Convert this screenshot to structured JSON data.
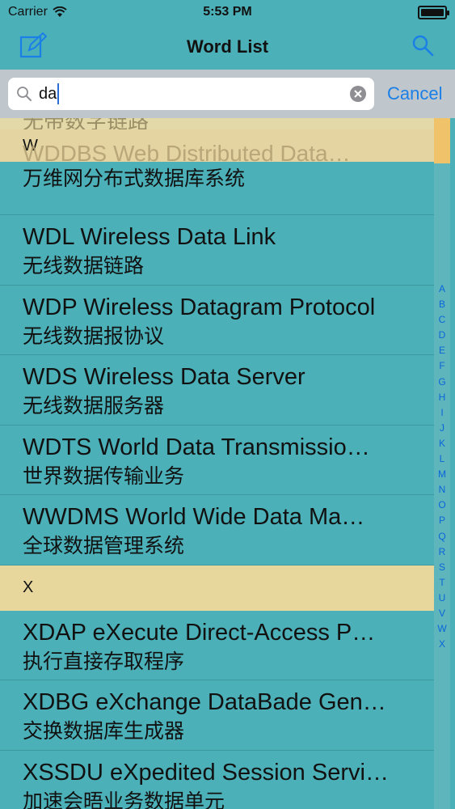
{
  "status_bar": {
    "carrier": "Carrier",
    "time": "5:53 PM"
  },
  "nav": {
    "title": "Word List",
    "left_icon": "compose-icon",
    "right_icon": "search-icon"
  },
  "search": {
    "value": "da",
    "cancel_label": "Cancel"
  },
  "peek_text": "无带数字链路",
  "sections": [
    {
      "header": "W",
      "ghost": "WDDBS Web Distributed Data…",
      "rows": [
        {
          "term": "",
          "meaning": "万维网分布式数据库系统"
        },
        {
          "term": "WDL Wireless Data Link",
          "meaning": "无线数据链路"
        },
        {
          "term": "WDP Wireless Datagram Protocol",
          "meaning": "无线数据报协议"
        },
        {
          "term": "WDS Wireless Data Server",
          "meaning": "无线数据服务器"
        },
        {
          "term": "WDTS World Data Transmissio…",
          "meaning": "世界数据传输业务"
        },
        {
          "term": "WWDMS World Wide Data Ma…",
          "meaning": "全球数据管理系统"
        }
      ]
    },
    {
      "header": "X",
      "rows": [
        {
          "term": "XDAP eXecute Direct-Access P…",
          "meaning": "执行直接存取程序"
        },
        {
          "term": "XDBG eXchange DataBade Gen…",
          "meaning": "交换数据库生成器"
        },
        {
          "term": "XSSDU eXpedited Session Servi…",
          "meaning": "加速会晤业务数据单元"
        }
      ]
    }
  ],
  "index_letters": [
    "A",
    "B",
    "C",
    "D",
    "E",
    "F",
    "G",
    "H",
    "I",
    "J",
    "K",
    "L",
    "M",
    "N",
    "O",
    "P",
    "Q",
    "R",
    "S",
    "T",
    "U",
    "V",
    "W",
    "X"
  ],
  "colors": {
    "background": "#4cb0b8",
    "section_header": "#e8d79d",
    "accent": "#1a7fe6"
  }
}
